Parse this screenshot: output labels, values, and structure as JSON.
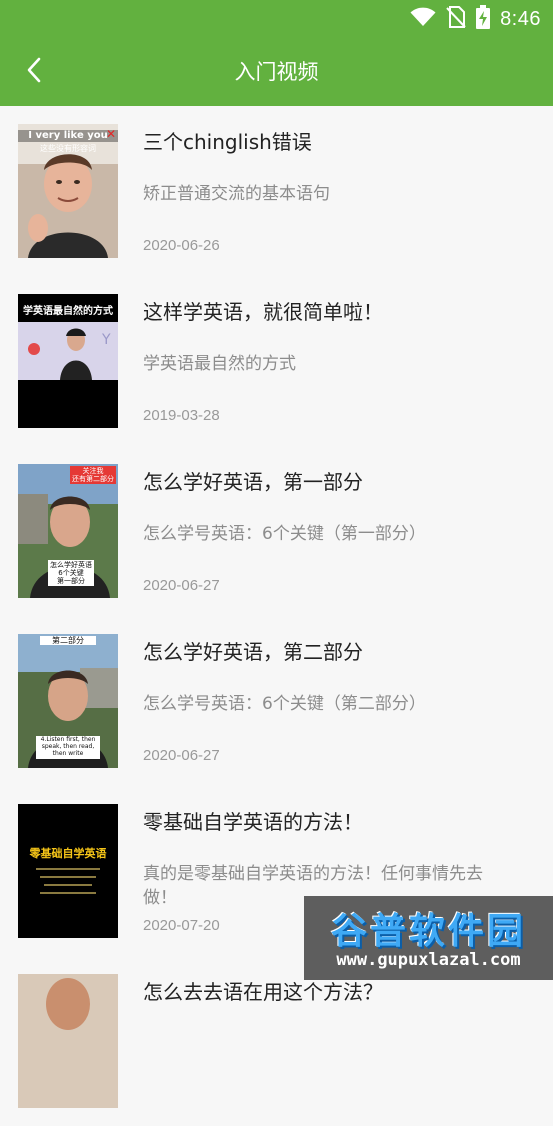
{
  "status_bar": {
    "time": "8:46",
    "icons": [
      "wifi-icon",
      "no-sim-icon",
      "battery-charging-icon"
    ]
  },
  "header": {
    "title": "入门视频",
    "back_icon": "chevron-left-icon",
    "background": "#62b13f"
  },
  "items": [
    {
      "title": "三个chinglish错误",
      "desc": "矫正普通交流的基本语句",
      "date": "2020-06-26",
      "thumb_text": [
        "I very like you",
        "这些没有形容词"
      ]
    },
    {
      "title": "这样学英语，就很简单啦！",
      "desc": "学英语最自然的方式",
      "date": "2019-03-28",
      "thumb_text": [
        "学英语最自然的方式"
      ]
    },
    {
      "title": "怎么学好英语，第一部分",
      "desc": "怎么学号英语：6个关键（第一部分）",
      "date": "2020-06-27",
      "thumb_text": [
        "关注我",
        "还有第二部分",
        "怎么学好英语",
        "6个关键",
        "第一部分"
      ]
    },
    {
      "title": "怎么学好英语，第二部分",
      "desc": "怎么学号英语：6个关键（第二部分）",
      "date": "2020-06-27",
      "thumb_text": [
        "第二部分",
        "4.Listen first, then",
        "speak, then read,",
        "then write"
      ]
    },
    {
      "title": "零基础自学英语的方法！",
      "desc": "真的是零基础自学英语的方法！任何事情先去做！",
      "date": "2020-07-20",
      "thumb_text": [
        "零基础自学英语"
      ]
    },
    {
      "title": "怎么去去语在用这个方法？",
      "desc": "",
      "date": ""
    }
  ],
  "watermark": {
    "title": "谷普软件园",
    "url": "www.gupuxlazal.com"
  }
}
